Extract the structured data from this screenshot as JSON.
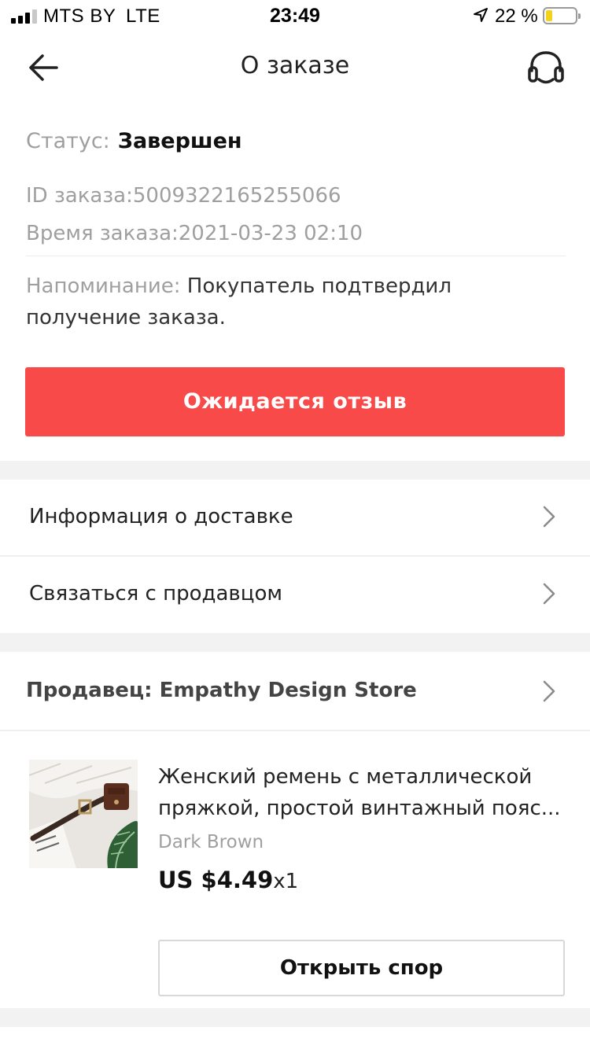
{
  "status_bar": {
    "carrier": "MTS BY",
    "network": "LTE",
    "time": "23:49",
    "battery": "22 %",
    "battery_level": 0.22
  },
  "nav": {
    "title": "О заказе",
    "back_icon": "arrow-left-icon",
    "support_icon": "headset-icon"
  },
  "order": {
    "status_label": "Статус:",
    "status_value": "Завершен",
    "id_text": "ID заказа:5009322165255066",
    "time_text": "Время заказа:2021-03-23 02:10",
    "reminder_label": "Напоминание:",
    "reminder_text": " Покупатель подтвердил получение заказа."
  },
  "review_button": "Ожидается отзыв",
  "menu": {
    "delivery": "Информация о доставке",
    "contact_seller": "Связаться с продавцом"
  },
  "seller": {
    "label": "Продавец: Empathy Design Store"
  },
  "product": {
    "title": "Женский ремень с металлической пряжкой, простой винтажный пояс...",
    "variant": "Dark Brown",
    "price": "US $4.49",
    "quantity": "x1"
  },
  "dispute_button": "Открыть спор",
  "colors": {
    "accent_red": "#f94a4a",
    "section_gray": "#f2f2f2",
    "secondary_text": "#9f9f9f"
  }
}
